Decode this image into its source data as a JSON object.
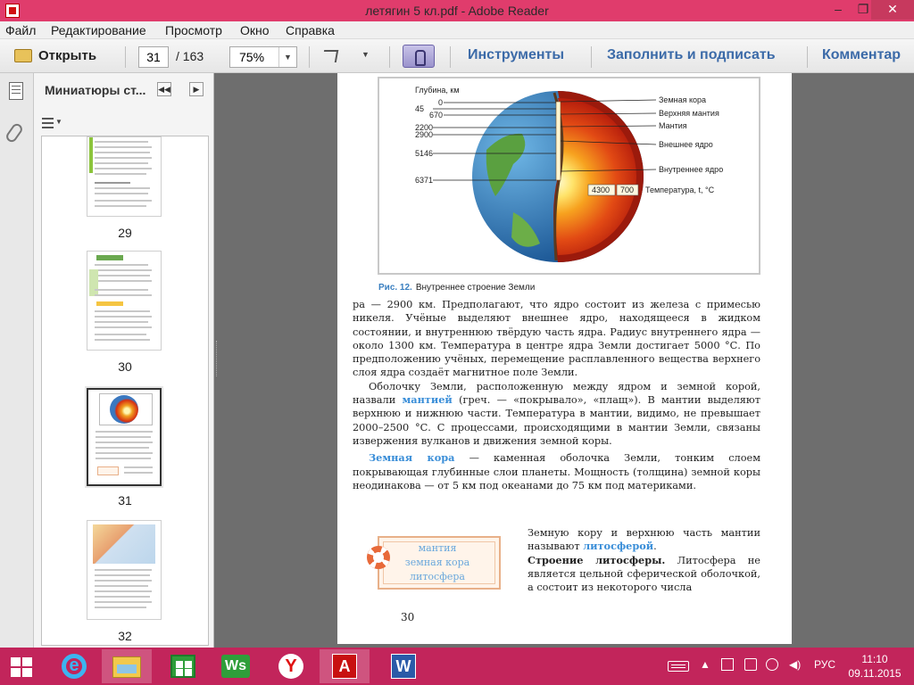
{
  "window": {
    "title": "летягин 5 кл.pdf - Adobe Reader"
  },
  "menu": {
    "items": [
      "Файл",
      "Редактирование",
      "Просмотр",
      "Окно",
      "Справка"
    ]
  },
  "toolbar": {
    "open_label": "Открыть",
    "page_current": "31",
    "page_total": "/ 163",
    "zoom": "75%",
    "tools_label": "Инструменты",
    "fill_sign_label": "Заполнить и подписать",
    "comment_label": "Комментар"
  },
  "thumbnails": {
    "title": "Миниатюры ст...",
    "pages": [
      {
        "number": "29"
      },
      {
        "number": "30"
      },
      {
        "number": "31",
        "selected": true
      },
      {
        "number": "32"
      }
    ]
  },
  "figure": {
    "depth_title": "Глубина, км",
    "depths": [
      "0",
      "45",
      "670",
      "2200",
      "2900",
      "5146",
      "6371"
    ],
    "layers": [
      "Земная кора",
      "Верхняя мантия",
      "Мантия",
      "Внешнее ядро",
      "Внутреннее ядро"
    ],
    "temp_values": [
      "4300",
      "700"
    ],
    "temp_label": "Температура, t, °C",
    "caption_num": "Рис. 12.",
    "caption_text": "Внутреннее строение Земли"
  },
  "body": {
    "p1": "ра — 2900 км. Предполагают, что ядро состоит из железа с примесью никеля. Учёные выделяют внешнее ядро, находящееся в жидком состоянии, и внутреннюю твёрдую часть ядра. Радиус внутреннего ядра — около 1300 км. Температура в центре ядра Земли достигает 5000 °С. По предположению учёных, перемещение расплавленного вещества верхнего слоя ядра создаёт магнитное поле Земли.",
    "p2_a": "Оболочку Земли, расположенную между ядром и земной корой, назвали ",
    "p2_kw": "мантией",
    "p2_b": " (греч. — «покрывало», «плащ»). В мантии выделяют верхнюю и нижнюю части. Температура в мантии, видимо, не превышает 2000–2500 °С. С процессами, происходящими в мантии Земли, связаны извержения вулканов и движения земной коры.",
    "p3_kw": "Земная кора",
    "p3_b": " — каменная оболочка Земли, тонким слоем покрывающая глубинные слои планеты. Мощность (толщина) земной коры неодинакова — от 5 км под океанами до 75 км под материками.",
    "p4_a": "Земную кору и верхнюю часть мантии называют ",
    "p4_kw": "литосферой",
    "p4_b": ".",
    "p5_head": "Строение литосферы.",
    "p5_b": " Литосфера не является цельной сферической оболочкой, а состоит из некоторого числа",
    "side_words": [
      "мантия",
      "земная кора",
      "литосфера"
    ],
    "page_number": "30"
  },
  "tray": {
    "lang": "РУС",
    "time": "11:10",
    "date": "09.11.2015"
  },
  "colors": {
    "titlebar": "#e03c6c",
    "taskbar": "#c2255b",
    "keyword": "#3a8ed8",
    "link": "#3b6aa8"
  }
}
